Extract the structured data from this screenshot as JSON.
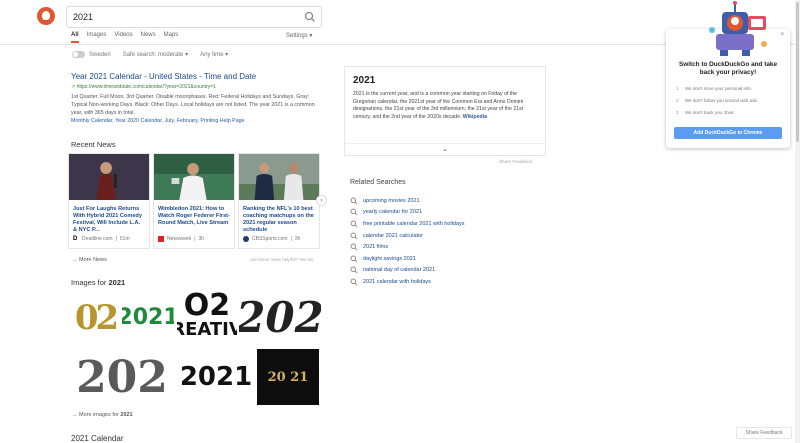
{
  "search": {
    "query": "2021"
  },
  "tabs": [
    "All",
    "Images",
    "Videos",
    "News",
    "Maps"
  ],
  "settings_label": "Settings",
  "filters": {
    "region": "Sweden",
    "safe_search": "Safe search: moderate",
    "time": "Any time"
  },
  "result": {
    "title": "Year 2021 Calendar - United States - Time and Date",
    "url": "https://www.timeanddate.com/calendar/?year=2021&country=1",
    "snippet": "1st Quarter. Full Moon. 3rd Quarter. Disable moonphases. Red: Federal Holidays and Sundays. Gray: Typical Non-working Days. Black: Other Days. Local holidays are not listed. The year 2021 is a common year, with 365 days in total.",
    "links": "Monthly Calendar,  Year 2020 Calendar,  July,  February,  Printing Help Page"
  },
  "recent_news": {
    "title": "Recent News",
    "items": [
      {
        "headline": "Just For Laughs Returns With Hybrid 2021 Comedy Festival, Will Include L.A. & NYC P...",
        "source": "Deadline.com",
        "age": "51m"
      },
      {
        "headline": "Wimbledon 2021: How to Watch Roger Federer First-Round Match, Live Stream",
        "source": "Newsweek",
        "age": "3h"
      },
      {
        "headline": "Ranking the NFL's 10 best coaching matchups on the 2021 regular season schedule",
        "source": "CBSSports.com",
        "age": "3h"
      }
    ],
    "more": "More News",
    "helpful": "Are these news helpful?  Yes  No"
  },
  "images": {
    "title_prefix": "Images for ",
    "title_query": "2021",
    "more_prefix": "More images for ",
    "more_query": "2021",
    "tiles": [
      "02",
      "2021",
      "O2",
      "REATIV",
      "202",
      "202",
      "2021",
      "20 21"
    ]
  },
  "next_section_title": "2021 Calendar",
  "infobox": {
    "title": "2021",
    "text": "2021 is the current year, and is a common year starting on Friday of the Gregorian calendar, the 2021st year of the Common Era and Anno Domini designations, the 21st year of the 3rd millennium, the 21st year of the 21st century, and the 2nd year of the 2020s decade.",
    "source": "Wikipedia",
    "share": "Share Feedback"
  },
  "related": {
    "title": "Related Searches",
    "items": [
      "upcoming movies 2021",
      "yearly calendar for 2021",
      "free printable calendar 2021 with holidays",
      "calendar 2021 calculator",
      "2021 films",
      "daylight savings 2021",
      "national day of calendar 2021",
      "2021 calendar with holidays"
    ]
  },
  "popup": {
    "title": "Switch to DuckDuckGo and take back your privacy!",
    "points": [
      "We don't store your personal info.",
      "We don't follow you around with ads.",
      "We don't track you. Ever."
    ],
    "cta": "Add DuckDuckGo to Chrome",
    "close": "×"
  },
  "share_feedback": "Share Feedback",
  "colors": {
    "accent": "#de5833",
    "link": "#1a4b8c",
    "cta": "#5b9bf0"
  }
}
